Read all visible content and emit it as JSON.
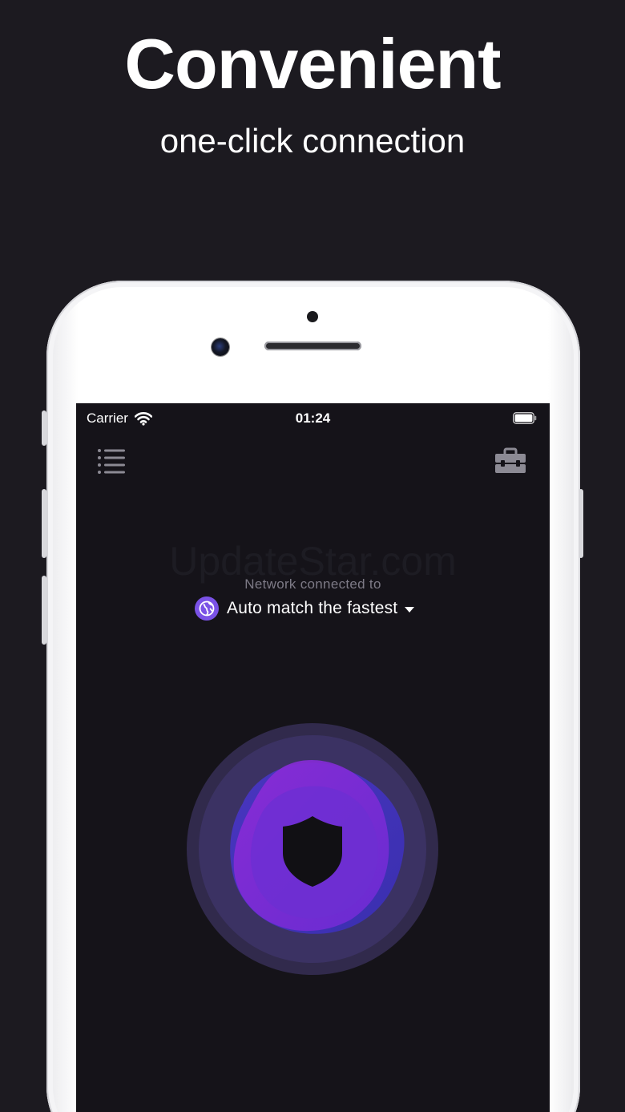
{
  "promo": {
    "headline": "Convenient",
    "subheadline": "one-click connection"
  },
  "status_bar": {
    "carrier": "Carrier",
    "time": "01:24",
    "icons": [
      "wifi-icon",
      "battery-icon"
    ]
  },
  "toolbar": {
    "left_icon": "menu-list-icon",
    "right_icon": "toolbox-icon"
  },
  "watermark": "UpdateStar.com",
  "connection": {
    "caption": "Network connected to",
    "server": "Auto match the fastest",
    "server_icon": "globe-icon",
    "dropdown_icon": "caret-down-icon",
    "button_icon": "shield-icon"
  },
  "colors": {
    "background": "#1c1a20",
    "screen": "#151319",
    "accent": "#7a52e6",
    "button_purple": "#6b2fd0",
    "halo": "#3a3260"
  }
}
